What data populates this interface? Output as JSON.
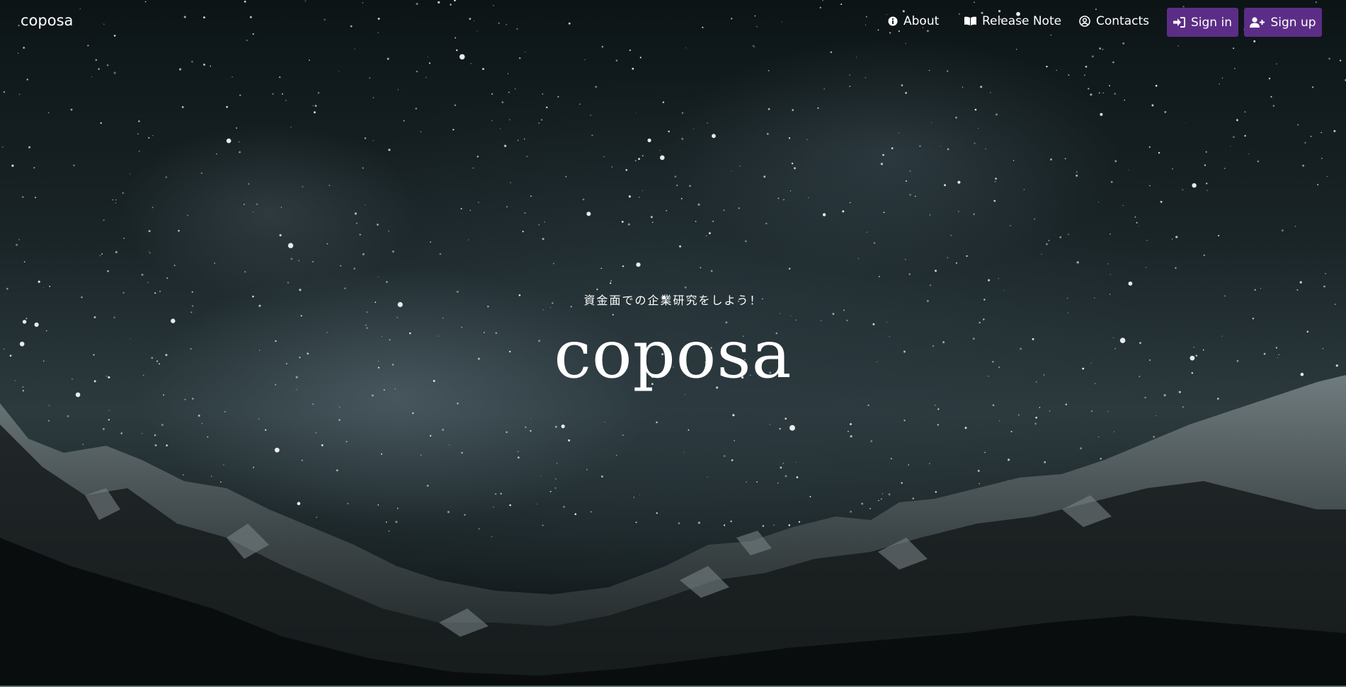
{
  "nav": {
    "brand": "coposa",
    "links": [
      {
        "label": "About",
        "icon": "info-circle-icon"
      },
      {
        "label": "Release Note",
        "icon": "book-open-icon"
      },
      {
        "label": "Contacts",
        "icon": "user-circle-icon"
      }
    ],
    "sign_in_label": "Sign in",
    "sign_up_label": "Sign up"
  },
  "hero": {
    "tagline": "資金面での企業研究をしよう！",
    "title": "coposa"
  },
  "colors": {
    "button_bg": "#5c2d86",
    "text": "#ffffff",
    "sky_dark": "#0c1416"
  }
}
